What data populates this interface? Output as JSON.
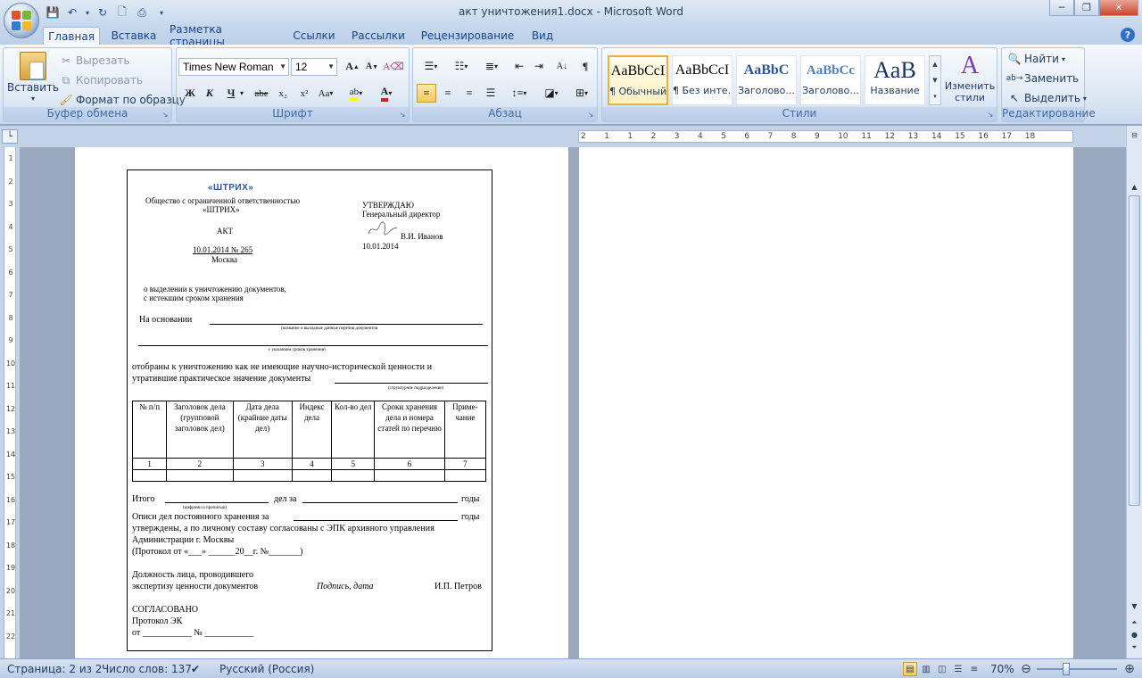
{
  "window": {
    "title": "акт уничтожения1.docx - Microsoft Word",
    "minimize": "─",
    "maximize": "❐",
    "close": "✕"
  },
  "tabs": [
    "Главная",
    "Вставка",
    "Разметка страницы",
    "Ссылки",
    "Рассылки",
    "Рецензирование",
    "Вид"
  ],
  "clipboard": {
    "label": "Буфер обмена",
    "paste": "Вставить",
    "cut": "Вырезать",
    "copy": "Копировать",
    "format_painter": "Формат по образцу"
  },
  "font": {
    "label": "Шрифт",
    "name": "Times New Roman",
    "size": "12",
    "bold": "Ж",
    "italic": "К",
    "underline": "Ч",
    "strike": "abe",
    "subscript": "x₂",
    "superscript": "x²",
    "change_case": "Aa",
    "grow": "A",
    "shrink": "A"
  },
  "paragraph": {
    "label": "Абзац",
    "pilcrow": "¶"
  },
  "styles": {
    "label": "Стили",
    "items": [
      {
        "preview": "AaBbCcI",
        "name": "¶ Обычный"
      },
      {
        "preview": "AaBbCcI",
        "name": "¶ Без инте..."
      },
      {
        "preview": "AaBbC",
        "name": "Заголово..."
      },
      {
        "preview": "AaBbCc",
        "name": "Заголово..."
      },
      {
        "preview": "AaB",
        "name": "Название"
      }
    ],
    "change": "Изменить стили"
  },
  "editing": {
    "label": "Редактирование",
    "find": "Найти",
    "replace": "Заменить",
    "select": "Выделить"
  },
  "ruler_ticks": [
    "2",
    "1",
    "1",
    "2",
    "3",
    "4",
    "5",
    "6",
    "7",
    "8",
    "9",
    "10",
    "11",
    "12",
    "13",
    "14",
    "15",
    "16",
    "17",
    "18"
  ],
  "document": {
    "logo": "«ШТРИХ»",
    "org_line1": "Общество с ограниченной ответственностью",
    "org_line2": "«ШТРИХ»",
    "act": "АКТ",
    "date_num": "10.01.2014 № 265",
    "city": "Москва",
    "approve": "УТВЕРЖДАЮ",
    "director": "Генеральный директор",
    "director_name": "В.И. Иванов",
    "approve_date": "10.01.2014",
    "subject1": "о выделении к уничтожению документов,",
    "subject2": "с истекшим сроком хранения",
    "basis": "На основании",
    "hint1": "(название и выходные данные перечня документов",
    "hint2": "с указанием сроков хранения)",
    "body1": "отобраны к уничтожению как не имеющие научно-исторической ценности и",
    "body2": "утратившие практическое значение документы",
    "hint3": "(структурное подразделение)",
    "table_headers": [
      "№ п/п",
      "Заголовок дела (групповой заголовок дел)",
      "Дата дела (крайние даты дел)",
      "Индекс дела",
      "Кол-во дел",
      "Сроки хранения дела и номера статей по перечню",
      "Приме-чание"
    ],
    "table_nums": [
      "1",
      "2",
      "3",
      "4",
      "5",
      "6",
      "7"
    ],
    "total_prefix": "Итого",
    "total_mid": "дел за",
    "total_suffix": "годы",
    "hint4": "(цифрами и прописью)",
    "inv_prefix": "Описи дел постоянного хранения за",
    "inv_suffix": "годы",
    "inv2": "утверждены, а по личному составу согласованы с ЭПК архивного управления",
    "inv3": "Администрации г. Москвы",
    "protocol": "(Протокол от «___» ______20__г. №_______)",
    "pos1": "Должность лица, проводившего",
    "pos2": "экспертизу ценности документов",
    "sign": "Подпись, дата",
    "sign_name": "И.П. Петров",
    "agreed": "СОГЛАСОВАНО",
    "ek": "Протокол ЭК",
    "from": "от ___________ № ___________"
  },
  "status": {
    "page": "Страница: 2 из 2",
    "words": "Число слов: 137",
    "lang": "Русский (Россия)",
    "zoom": "70%",
    "zoom_level": 0.35
  },
  "colors": {
    "accent": "#15428b",
    "ribbon": "#dbe6f4",
    "selected": "#f7c95d"
  }
}
